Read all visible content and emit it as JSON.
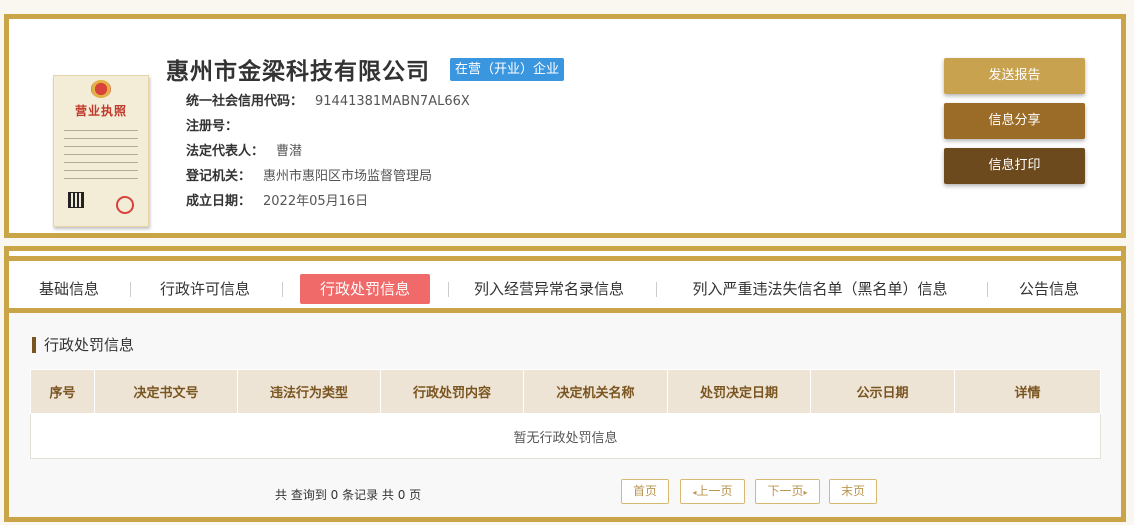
{
  "company": {
    "name": "惠州市金梁科技有限公司",
    "status": "在营（开业）企业",
    "fields": [
      {
        "label": "统一社会信用代码：",
        "value": "91441381MABN7AL66X"
      },
      {
        "label": "注册号：",
        "value": ""
      },
      {
        "label": "法定代表人：",
        "value": "曹潜"
      },
      {
        "label": "登记机关：",
        "value": "惠州市惠阳区市场监督管理局"
      },
      {
        "label": "成立日期：",
        "value": "2022年05月16日"
      }
    ],
    "license_image": {
      "title": "营业执照",
      "icon": "business-license-icon"
    }
  },
  "actions": {
    "send_report": "发送报告",
    "share": "信息分享",
    "print": "信息打印"
  },
  "tabs": [
    {
      "label": "基础信息",
      "active": false
    },
    {
      "label": "行政许可信息",
      "active": false
    },
    {
      "label": "行政处罚信息",
      "active": true
    },
    {
      "label": "列入经营异常名录信息",
      "active": false
    },
    {
      "label": "列入严重违法失信名单（黑名单）信息",
      "active": false
    },
    {
      "label": "公告信息",
      "active": false
    }
  ],
  "penalty_section": {
    "title": "行政处罚信息",
    "columns": [
      "序号",
      "决定书文号",
      "违法行为类型",
      "行政处罚内容",
      "决定机关名称",
      "处罚决定日期",
      "公示日期",
      "详情"
    ],
    "empty_text": "暂无行政处罚信息"
  },
  "pagination": {
    "summary": "共 查询到 0 条记录 共 0 页",
    "first": "首页",
    "prev": "上一页",
    "next": "下一页",
    "last": "末页"
  },
  "colors": {
    "frame_gold": "#c9a547",
    "btn_send": "#c8a24f",
    "btn_share": "#9b6b28",
    "btn_print": "#6d4a1d",
    "status_blue": "#3b96e0",
    "active_tab": "#f06a6a"
  }
}
